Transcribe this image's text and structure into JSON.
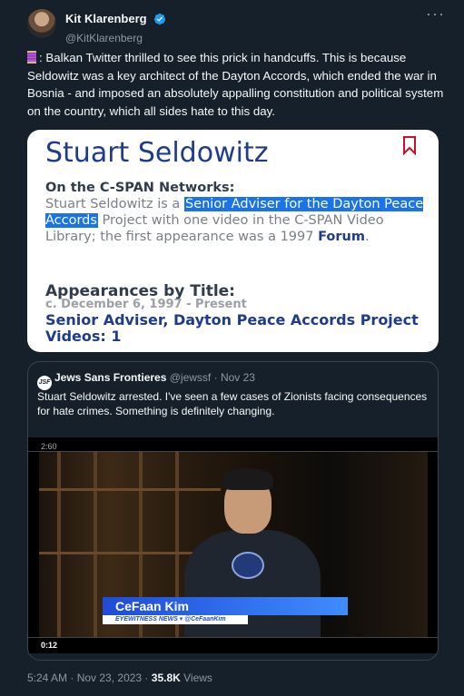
{
  "author": {
    "display_name": "Kit Klarenberg",
    "handle": "@KitKlarenberg",
    "verified_icon": "verified-badge-icon",
    "more_label": "···"
  },
  "tweet": {
    "text": ": Balkan Twitter thrilled to see this prick in handcuffs. This is because Seldowitz was a key architect of the Dayton Accords, which ended the war in Bosnia - and imposed an absolutely appalling constitution and political system on the country, which all sides hate to this day.",
    "emoji_icon": "thread-spool-icon"
  },
  "screenshot_card": {
    "title": "Stuart Seldowitz",
    "section_heading": "On the C-SPAN Networks:",
    "body_prefix": "Stuart Seldowitz is a ",
    "body_highlight": "Senior Adviser for the Dayton Peace Accords",
    "body_middle": " Project with one video in the C-SPAN Video Library; the first appearance was a 1997 ",
    "body_link": "Forum",
    "body_suffix": ".",
    "appearances_heading": "Appearances by Title:",
    "appearances_date": "c. December 6, 1997 - Present",
    "appearances_title": "Senior Adviser, Dayton Peace Accords Project Videos: 1",
    "bookmark_icon": "bookmark-icon"
  },
  "quoted_tweet": {
    "avatar_text": "JSF",
    "display_name": "Jews Sans Frontieres",
    "handle": "@jewssf",
    "separator": " · ",
    "date": "Nov 23",
    "text": "Stuart Seldowitz arrested. I've seen a few cases of Zionists facing consequences for hate crimes. Something is definitely changing.",
    "video": {
      "top_time": "2:60",
      "lower_third_name": "CeFaan Kim",
      "lower_third_sub": "EYEWITNESS NEWS ▾ @CeFaanKim",
      "duration": "0:12"
    }
  },
  "footer": {
    "time": "5:24 AM",
    "separator": " · ",
    "date": "Nov 23, 2023",
    "views_count": "35.8K",
    "views_label": "Views"
  }
}
